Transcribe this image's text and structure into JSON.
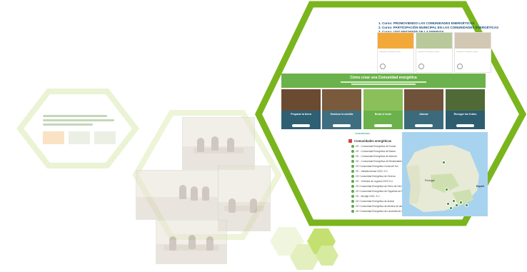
{
  "courses": {
    "items": [
      "1. Curso: PROMOVIENDO LAS COMUNIDADES ENERGÉTICAS",
      "2. Curso: PARTICIPACIÓN MUNICIPAL EN LAS COMUNIDADES ENERGÉTICAS",
      "3. Curso: USO EFICIENTE DE LA ENERGÍA"
    ]
  },
  "how_to": {
    "title": "Cómo crear una Comunidad energética",
    "steps": [
      {
        "label": "Preparar la tierra",
        "color": "#2f5f72"
      },
      {
        "label": "Sembrar la semilla",
        "color": "#3e6e80"
      },
      {
        "label": "Brota el brote",
        "color": "#6bb24c"
      },
      {
        "label": "Abonar",
        "color": "#3a6a7b"
      },
      {
        "label": "Recoger los frutos",
        "color": "#2e5d70"
      }
    ]
  },
  "communities": {
    "heading": "COMUNIDADES",
    "title": "Comunidades energéticas",
    "items": [
      "CE - Comunidad Energética de Durcal",
      "CE - Comunidad Energética de Baeza",
      "CE - Comunidad Energética de Almería",
      "CE - Comunidad Energética de Benalmádena",
      "CE Comunidad Energética Costa del Sol",
      "CE - Valdelumbrosa 2022, S.C.",
      "CE Comunidad Energética de Gerena",
      "CE - Vivienda de Lugares 2022 S.C.",
      "CE Comunidad Energética de Otero de Herreros",
      "CE Comunidad Energética de Olgueiras de Rua",
      "CE - Montija 2022, S.C.",
      "CE Comunidad Energética de Arahal",
      "CE Comunidad Energética de Medina de las Torres",
      "CE Comunidad Energética de Lancerilla de la Jara"
    ]
  },
  "map": {
    "labels": [
      "Portugal",
      "Españ"
    ]
  },
  "colors": {
    "hex_green": "#7ab51d",
    "hex_light": "#e6f0c8",
    "band_green": "#6bb24c"
  }
}
